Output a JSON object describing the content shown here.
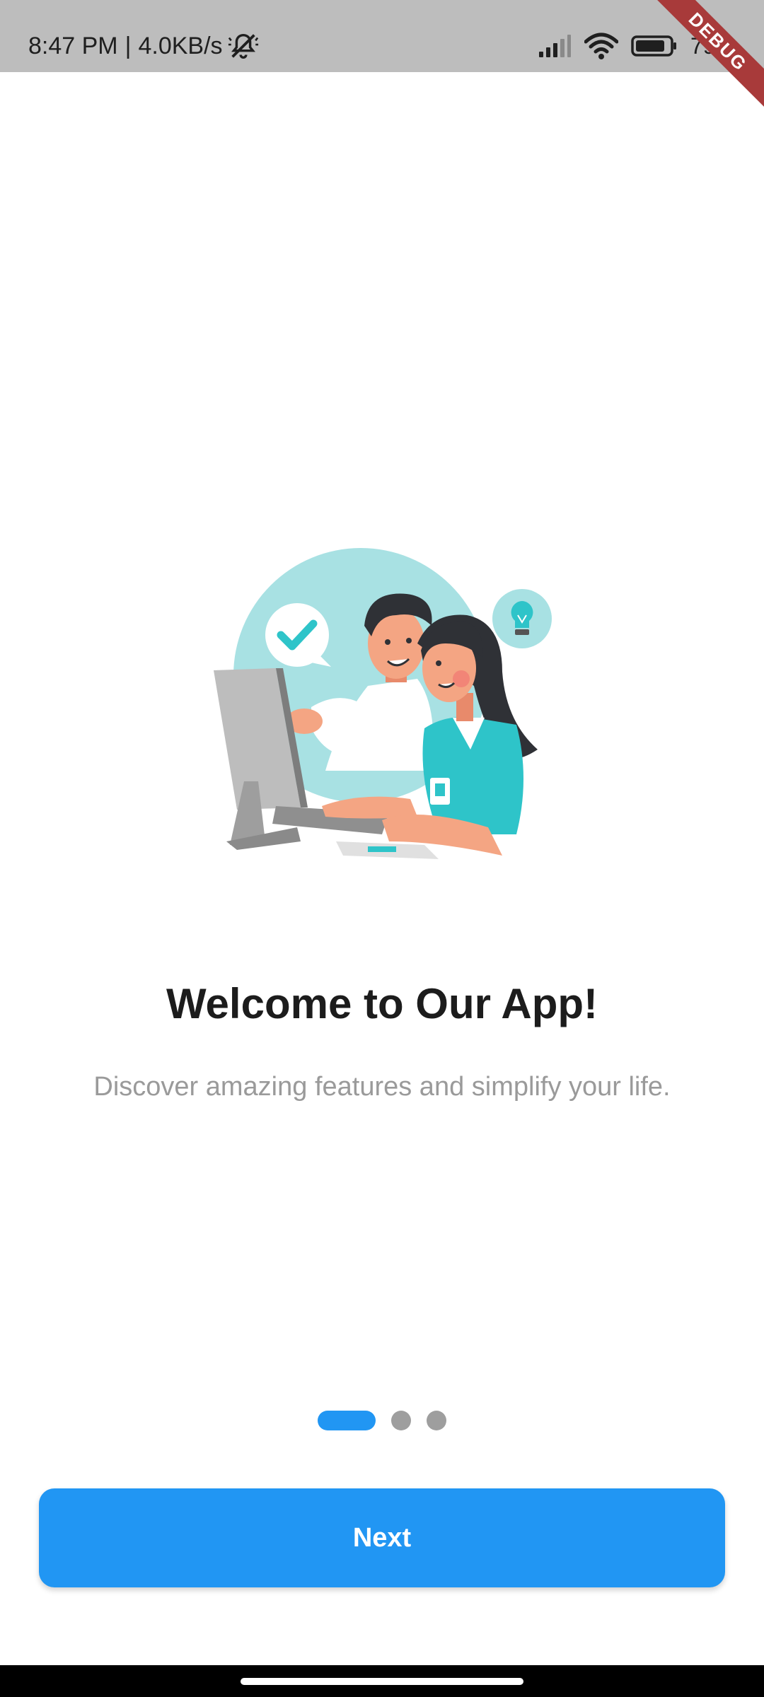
{
  "status_bar": {
    "time": "8:47 PM",
    "separator": "|",
    "network_speed": "4.0KB/s",
    "battery": "79%",
    "icons": [
      "mute-icon",
      "signal-icon",
      "wifi-icon",
      "battery-icon"
    ]
  },
  "debug_banner": "DEBUG",
  "onboarding": {
    "title": "Welcome to Our App!",
    "subtitle": "Discover amazing features and simplify your life.",
    "page_indicator": {
      "current_page": 1,
      "total_pages": 3
    },
    "next_label": "Next"
  },
  "colors": {
    "primary": "#2196f3",
    "inactive_dot": "#9e9e9e",
    "title": "#1c1c1c",
    "subtitle": "#9a9a9a",
    "illustration_teal": "#2ec4c9",
    "illustration_circle": "#a8e1e3"
  }
}
